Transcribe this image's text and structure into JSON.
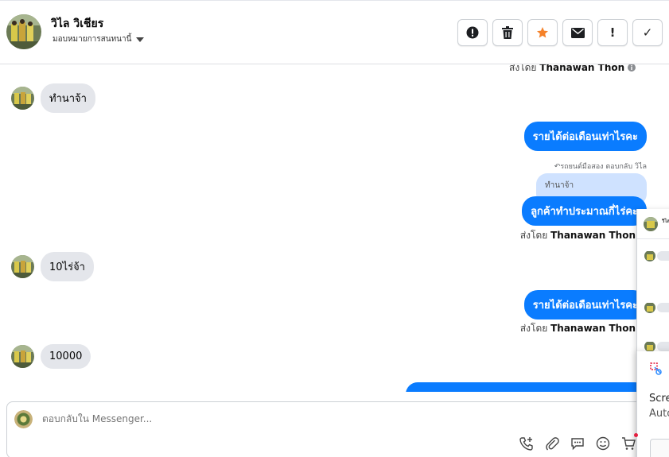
{
  "header": {
    "contact_name": "วิไล วิเชียร",
    "assign_label": "มอบหมายการสนทนานี้",
    "actions": [
      {
        "name": "mark-spam-button",
        "icon": "alert-circle-icon",
        "glyph": "!"
      },
      {
        "name": "delete-button",
        "icon": "trash-icon",
        "glyph": ""
      },
      {
        "name": "star-button",
        "icon": "star-icon",
        "glyph": ""
      },
      {
        "name": "mark-unread-button",
        "icon": "envelope-icon",
        "glyph": ""
      },
      {
        "name": "follow-up-button",
        "icon": "exclamation-icon",
        "glyph": "!"
      },
      {
        "name": "mark-done-button",
        "icon": "check-icon",
        "glyph": "✓"
      }
    ]
  },
  "thread": {
    "sent_by_prefix": "ส่งโดย",
    "sender_name": "Thanawan Thon",
    "messages": {
      "m1_in": "ทำนาจ้า",
      "m2_out": "รายได้ต่อเดือนเท่าไรคะ",
      "reply_meta": "รถยนต์มือสอง ตอบกลับ วิไล",
      "quoted_text": "ทำนาจ้า",
      "m3_out": "ลูกค้าทำประมาณกี่ไร่คะ",
      "m4_in": "10ไร่จ้า",
      "m5_out": "รายได้ต่อเดือนเท่าไรคะ",
      "m6_in": "10000"
    }
  },
  "composer": {
    "placeholder": "ตอบกลับใน Messenger...",
    "tools": [
      "phone-plus-icon",
      "paperclip-icon",
      "chat-bubble-icon",
      "emoji-icon",
      "shopping-cart-icon"
    ]
  },
  "side_panel": {
    "title_snippet": "วิไล",
    "toast_title": "Scre",
    "toast_sub": "Auto"
  },
  "colors": {
    "accent_blue": "#0a7cff",
    "incoming_bubble": "#e4e6eb",
    "quoted_bubble": "#cfe2ff",
    "star_orange": "#f5822a"
  }
}
